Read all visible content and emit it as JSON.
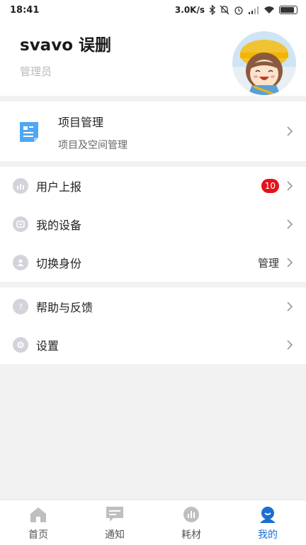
{
  "status_bar": {
    "time": "18:41",
    "net_speed": "3.0K/s"
  },
  "profile": {
    "name": "svavo 误删",
    "role": "管理员"
  },
  "project": {
    "title": "项目管理",
    "subtitle": "项目及空间管理",
    "icon": "document-icon"
  },
  "menu_group1": [
    {
      "label": "用户上报",
      "badge": "10",
      "icon": "report-icon"
    },
    {
      "label": "我的设备",
      "icon": "device-icon"
    },
    {
      "label": "切换身份",
      "value": "管理",
      "icon": "user-icon"
    }
  ],
  "menu_group2": [
    {
      "label": "帮助与反馈",
      "icon": "help-icon"
    },
    {
      "label": "设置",
      "icon": "gear-icon"
    }
  ],
  "tabbar": [
    {
      "label": "首页",
      "icon": "home-icon"
    },
    {
      "label": "通知",
      "icon": "message-icon"
    },
    {
      "label": "耗材",
      "icon": "chart-icon"
    },
    {
      "label": "我的",
      "icon": "profile-icon",
      "active": true
    }
  ],
  "colors": {
    "accent": "#1a6fd0",
    "badge": "#e3131b",
    "icon_gray": "#d3d3dc",
    "project_icon": "#4fa6f5"
  }
}
